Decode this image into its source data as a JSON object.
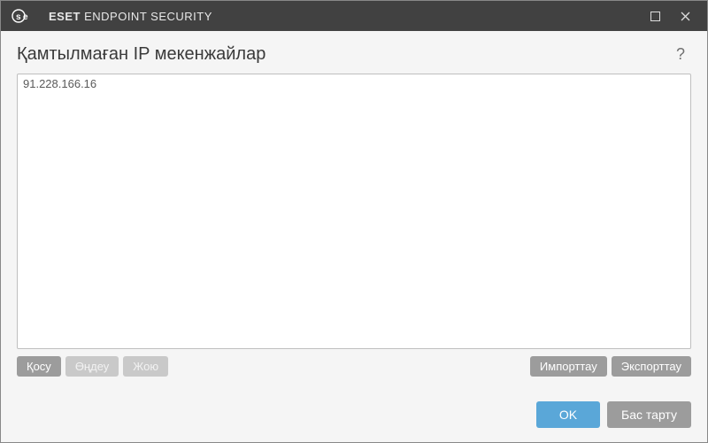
{
  "titlebar": {
    "brand_prefix": "ESET",
    "brand_suffix": "ENDPOINT SECURITY"
  },
  "page": {
    "title": "Қамтылмаған IP мекенжайлар",
    "help": "?"
  },
  "list": {
    "items": [
      "91.228.166.16"
    ]
  },
  "toolbar": {
    "add": "Қосу",
    "edit": "Өңдеу",
    "delete": "Жою",
    "import": "Импорттау",
    "export": "Экспорттау"
  },
  "footer": {
    "ok": "OK",
    "cancel": "Бас тарту"
  }
}
